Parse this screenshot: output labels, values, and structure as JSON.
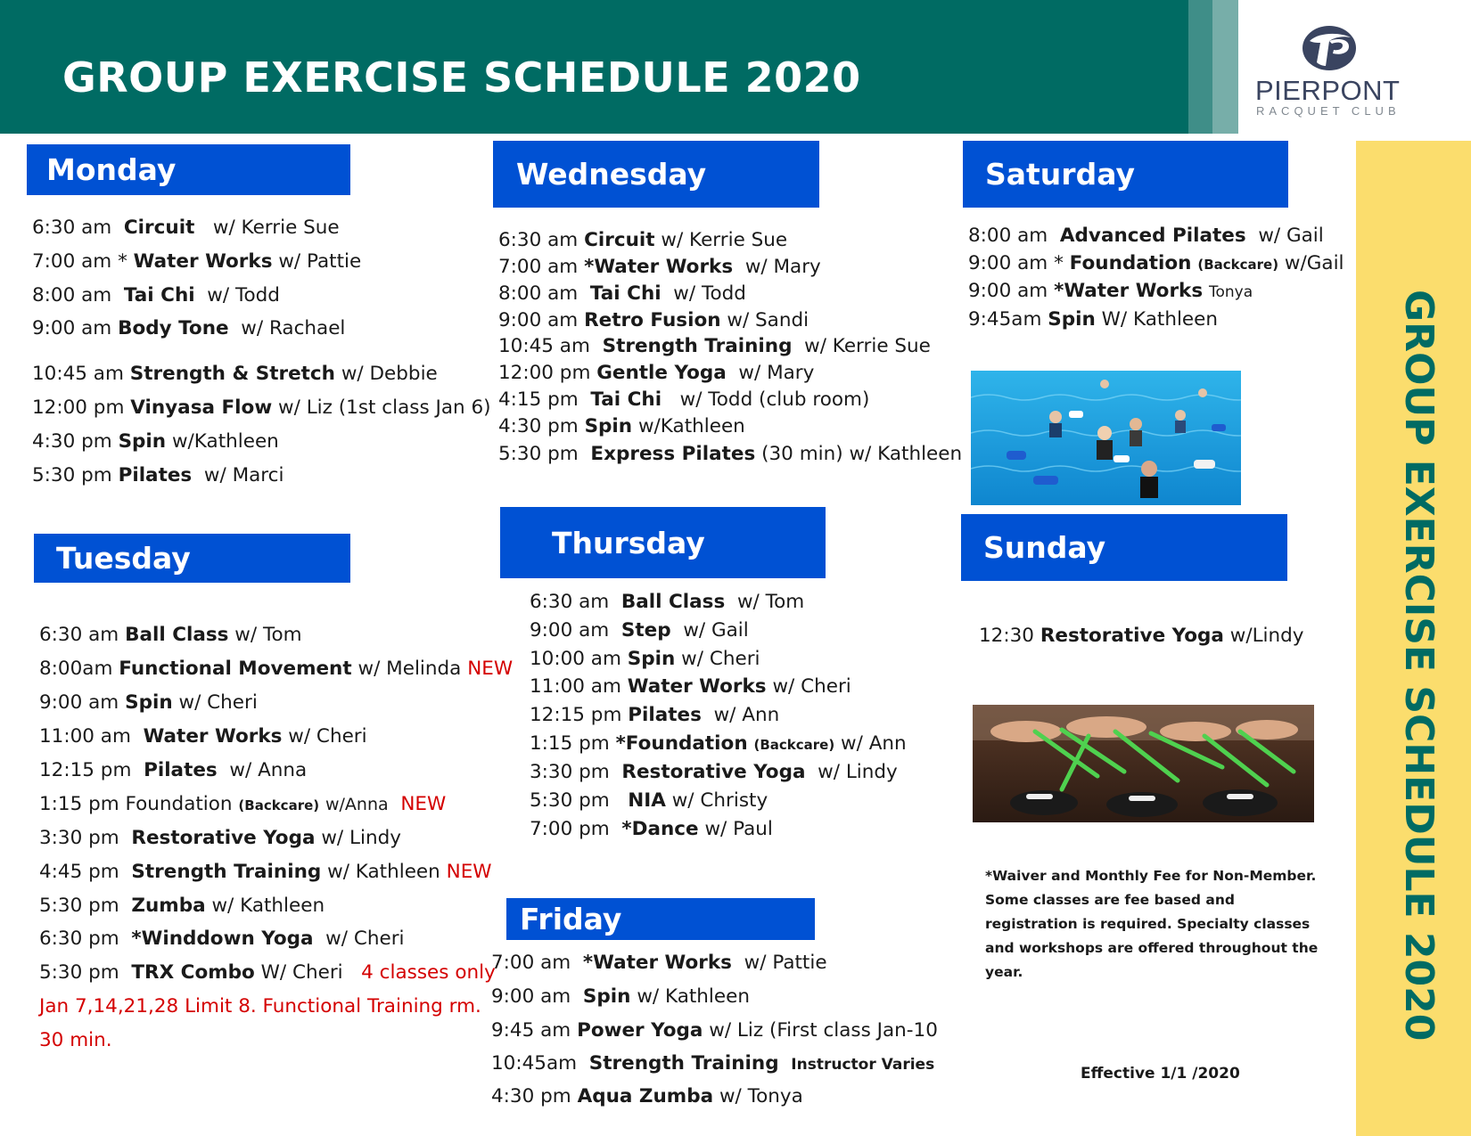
{
  "header": {
    "title": "GROUP EXERCISE SCHEDULE 2020",
    "logo_name": "PIERPONT",
    "logo_sub": "RACQUET CLUB",
    "logo_icon": "pierpont-logo-icon"
  },
  "side_title": "GROUP EXERCISE SCHEDULE 2020",
  "colors": {
    "header_bg": "#006b63",
    "day_header_bg": "#0051d3",
    "sidebar_bg": "#fbdd6d",
    "accent_red": "#d40000"
  },
  "days": {
    "monday": {
      "label": "Monday",
      "classes": [
        {
          "time": "6:30 am",
          "name": "Circuit",
          "instructor": "w/ Kerrie Sue"
        },
        {
          "time": "7:00 am *",
          "name": "Water Works",
          "instructor": "w/ Pattie"
        },
        {
          "time": "8:00 am",
          "name": "Tai Chi",
          "instructor": "w/ Todd"
        },
        {
          "time": "9:00 am",
          "name": "Body Tone",
          "instructor": "w/  Rachael"
        },
        {
          "time": "10:45 am",
          "name": "Strength & Stretch",
          "instructor": "w/ Debbie"
        },
        {
          "time": "12:00 pm",
          "name": "Vinyasa Flow",
          "instructor": "w/ Liz (1st class Jan 6)"
        },
        {
          "time": "4:30 pm",
          "name": "Spin",
          "instructor": "w/Kathleen"
        },
        {
          "time": "5:30 pm",
          "name": "Pilates",
          "instructor": "w/ Marci"
        }
      ]
    },
    "tuesday": {
      "label": "Tuesday",
      "classes": [
        {
          "time": "6:30 am",
          "name": "Ball Class",
          "instructor": "w/ Tom"
        },
        {
          "time": "8:00am",
          "name": "Functional Movement",
          "instructor": "w/ Melinda",
          "badge": "NEW"
        },
        {
          "time": "9:00 am",
          "name": "Spin",
          "instructor": "w/ Cheri"
        },
        {
          "time": "11:00 am",
          "name": "Water Works",
          "instructor": "w/ Cheri"
        },
        {
          "time": "12:15 pm",
          "name": "Pilates",
          "instructor": "w/ Anna"
        },
        {
          "time": "1:15 pm Foundation",
          "tag": "(Backcare)",
          "instructor": "w/Anna",
          "badge": "NEW"
        },
        {
          "time": "3:30 pm",
          "name": "Restorative Yoga",
          "instructor": "w/ Lindy"
        },
        {
          "time": "4:45 pm",
          "name": "Strength Training",
          "instructor": "w/ Kathleen",
          "badge": "NEW"
        },
        {
          "time": "5:30 pm",
          "name": "Zumba",
          "instructor": "w/ Kathleen"
        },
        {
          "time": "6:30 pm",
          "name": "*Winddown Yoga",
          "instructor": "w/ Cheri"
        },
        {
          "time": "5:30 pm",
          "name": "TRX Combo",
          "instructor": "W/ Cheri",
          "badge": "4 classes only"
        }
      ],
      "note_lines": [
        "Jan 7,14,21,28  Limit 8. Functional Training rm.",
        "30 min."
      ]
    },
    "wednesday": {
      "label": "Wednesday",
      "classes": [
        {
          "time": "6:30 am",
          "name": "Circuit",
          "instructor": "w/ Kerrie Sue"
        },
        {
          "time": "7:00 am",
          "name": "*Water Works",
          "instructor": "w/ Mary"
        },
        {
          "time": "8:00 am",
          "name": "Tai Chi",
          "instructor": "w/ Todd"
        },
        {
          "time": "9:00 am",
          "name": "Retro Fusion",
          "instructor": "w/ Sandi"
        },
        {
          "time": "10:45 am",
          "name": "Strength Training",
          "instructor": "w/ Kerrie Sue"
        },
        {
          "time": "12:00 pm",
          "name": "Gentle Yoga",
          "instructor": "w/ Mary"
        },
        {
          "time": "4:15 pm",
          "name": "Tai Chi",
          "instructor": "w/ Todd  (club room)"
        },
        {
          "time": "4:30 pm",
          "name": "Spin",
          "instructor": "w/Kathleen"
        },
        {
          "time": "5:30 pm",
          "name": "Express Pilates",
          "instructor": "(30 min) w/ Kathleen"
        }
      ]
    },
    "thursday": {
      "label": "Thursday",
      "classes": [
        {
          "time": "6:30 am",
          "name": "Ball Class",
          "instructor": "w/ Tom"
        },
        {
          "time": "9:00 am",
          "name": "Step",
          "instructor": "w/ Gail"
        },
        {
          "time": "10:00 am",
          "name": "Spin",
          "instructor": "w/ Cheri"
        },
        {
          "time": "11:00 am",
          "name": "Water Works",
          "instructor": "w/ Cheri"
        },
        {
          "time": "12:15 pm",
          "name": "Pilates",
          "instructor": "w/ Ann"
        },
        {
          "time": "1:15 pm",
          "name": "*Foundation",
          "tag": "(Backcare)",
          "instructor": "w/ Ann"
        },
        {
          "time": "3:30 pm",
          "name": "Restorative Yoga",
          "instructor": "w/ Lindy"
        },
        {
          "time": "5:30 pm",
          "name": "NIA",
          "instructor": "w/ Christy"
        },
        {
          "time": "7:00 pm",
          "name": "*Dance",
          "instructor": "w/ Paul"
        }
      ]
    },
    "friday": {
      "label": "Friday",
      "classes": [
        {
          "time": "7:00 am",
          "name": "*Water Works",
          "instructor": "w/ Pattie"
        },
        {
          "time": "9:00 am",
          "name": "Spin",
          "instructor": "w/ Kathleen"
        },
        {
          "time": "9:45 am",
          "name": "Power Yoga",
          "instructor": "w/ Liz (First class  Jan-10"
        },
        {
          "time": "10:45am",
          "name": "Strength Training",
          "tag": "Instructor Varies"
        },
        {
          "time": "4:30 pm",
          "name": "Aqua Zumba",
          "instructor": "w/ Tonya"
        }
      ]
    },
    "saturday": {
      "label": "Saturday",
      "classes": [
        {
          "time": "8:00 am",
          "name": "Advanced Pilates",
          "instructor": "w/ Gail"
        },
        {
          "time": "9:00 am *",
          "name": "Foundation",
          "tag": "(Backcare)",
          "instructor": "w/Gail"
        },
        {
          "time": "9:00 am",
          "name": "*Water Works",
          "small": "Tonya"
        },
        {
          "time": "9:45am",
          "name": "Spin",
          "instructor": "W/ Kathleen"
        }
      ]
    },
    "sunday": {
      "label": "Sunday",
      "classes": [
        {
          "time": "12:30",
          "name": "Restorative Yoga",
          "instructor": "w/Lindy"
        }
      ]
    }
  },
  "footnote": "*Waiver and Monthly Fee for Non-Member. Some classes are fee based and registration is required. Specialty classes and workshops are offered throughout the year.",
  "effective": "Effective  1/1 /2020"
}
